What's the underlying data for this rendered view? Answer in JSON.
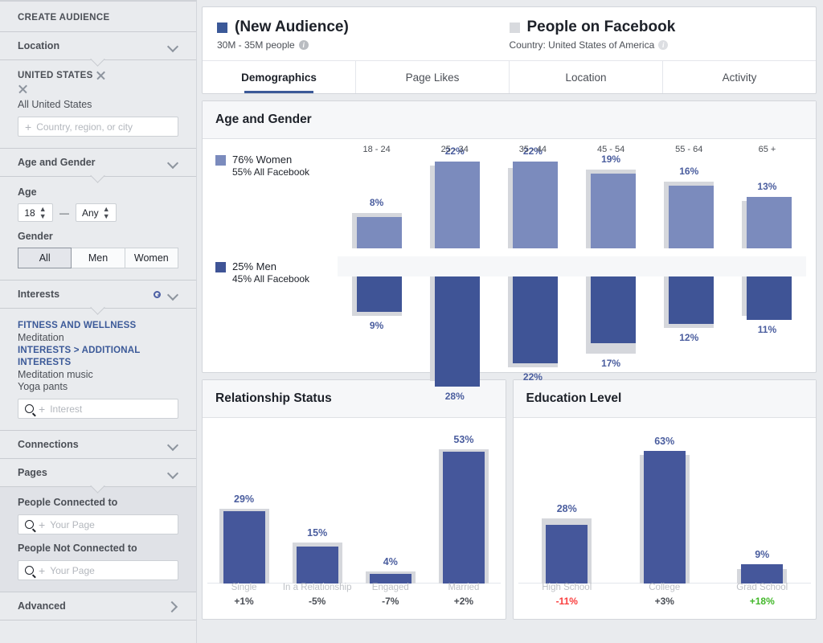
{
  "sidebar": {
    "title": "CREATE AUDIENCE",
    "sections": {
      "location": {
        "label": "Location",
        "country_header": "UNITED STATES",
        "country_item": "All United States",
        "input_placeholder": "Country, region, or city"
      },
      "age_gender": {
        "label": "Age and Gender",
        "age_label": "Age",
        "age_min": "18",
        "age_max": "Any",
        "dash": "—",
        "gender_label": "Gender",
        "gender_options": [
          "All",
          "Men",
          "Women"
        ],
        "gender_selected": "All"
      },
      "interests": {
        "label": "Interests",
        "groups": [
          {
            "category": "FITNESS AND WELLNESS",
            "items": [
              "Meditation"
            ]
          },
          {
            "category": "INTERESTS > ADDITIONAL INTERESTS",
            "items": [
              "Meditation music",
              "Yoga pants"
            ]
          }
        ],
        "input_placeholder": "Interest"
      },
      "connections": {
        "label": "Connections"
      },
      "pages": {
        "label": "Pages",
        "connected_label": "People Connected to",
        "connected_placeholder": "Your Page",
        "not_connected_label": "People Not Connected to",
        "not_connected_placeholder": "Your Page"
      },
      "advanced": {
        "label": "Advanced"
      }
    }
  },
  "header": {
    "audience": {
      "name": "(New Audience)",
      "subtitle": "30M - 35M people",
      "color": "#3b5998"
    },
    "comparison": {
      "name": "People on Facebook",
      "subtitle": "Country: United States of America",
      "color": "#d8dade"
    },
    "tabs": [
      {
        "label": "Demographics",
        "active": true
      },
      {
        "label": "Page Likes",
        "active": false
      },
      {
        "label": "Location",
        "active": false
      },
      {
        "label": "Activity",
        "active": false
      }
    ]
  },
  "age_gender_card": {
    "title": "Age and Gender",
    "legend": {
      "women": {
        "value": "76% Women",
        "baseline": "55% All Facebook",
        "color": "#7b8bbd"
      },
      "men": {
        "value": "25% Men",
        "baseline": "45% All Facebook",
        "color": "#3f5496"
      }
    }
  },
  "chart_data": [
    {
      "type": "bar",
      "id": "age-and-gender",
      "title": "Age and Gender",
      "orientation": "diverging-vertical",
      "categories": [
        "18 - 24",
        "25 - 34",
        "35 - 44",
        "45 - 54",
        "55 - 64",
        "65 +"
      ],
      "series": [
        {
          "name": "Women",
          "color": "#7b8bbd",
          "direction": "up",
          "values": [
            8,
            22,
            22,
            19,
            16,
            13
          ],
          "labels": [
            "8%",
            "22%",
            "22%",
            "19%",
            "16%",
            "13%"
          ]
        },
        {
          "name": "Men",
          "color": "#3f5496",
          "direction": "down",
          "values": [
            9,
            28,
            22,
            17,
            12,
            11
          ],
          "labels": [
            "9%",
            "28%",
            "22%",
            "17%",
            "12%",
            "11%"
          ]
        }
      ],
      "comparison": {
        "name": "All Facebook",
        "color": "#d5d7dc",
        "women_values": [
          9,
          21,
          20.5,
          20,
          17,
          12
        ],
        "men_values": [
          10,
          26.5,
          23,
          19.5,
          13,
          10
        ]
      },
      "legend": [
        "76% Women / 55% All Facebook",
        "25% Men / 45% All Facebook"
      ],
      "ylim": [
        0,
        30
      ],
      "grid": false,
      "legend_position": "left"
    },
    {
      "type": "bar",
      "id": "relationship-status",
      "title": "Relationship Status",
      "categories": [
        "Single",
        "In a Relationship",
        "Engaged",
        "Married"
      ],
      "values": [
        29,
        15,
        4,
        53
      ],
      "labels": [
        "29%",
        "15%",
        "4%",
        "53%"
      ],
      "deltas": [
        "+1%",
        "-5%",
        "-7%",
        "+2%"
      ],
      "delta_tones": [
        "neutral",
        "neutral",
        "neutral",
        "neutral"
      ],
      "comparison": {
        "name": "All Facebook",
        "color": "#d5d7dc",
        "values": [
          30,
          16.5,
          5,
          54
        ]
      },
      "ylim": [
        0,
        60
      ],
      "grid": false
    },
    {
      "type": "bar",
      "id": "education-level",
      "title": "Education Level",
      "categories": [
        "High School",
        "College",
        "Grad School"
      ],
      "values": [
        28,
        63,
        9
      ],
      "labels": [
        "28%",
        "63%",
        "9%"
      ],
      "deltas": [
        "-11%",
        "+3%",
        "+18%"
      ],
      "delta_tones": [
        "down",
        "neutral",
        "up"
      ],
      "comparison": {
        "name": "All Facebook",
        "color": "#d5d7dc",
        "values": [
          31,
          61,
          7
        ]
      },
      "ylim": [
        0,
        70
      ],
      "grid": false
    }
  ]
}
